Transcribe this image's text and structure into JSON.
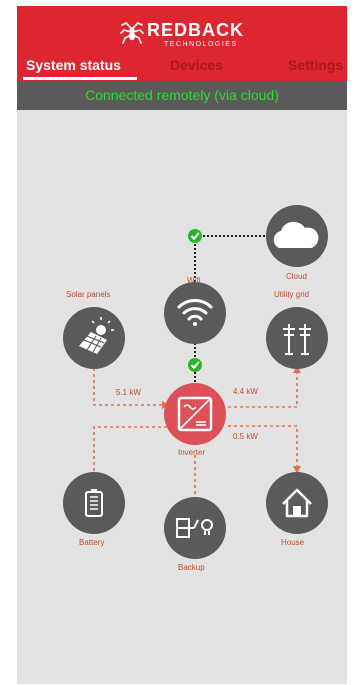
{
  "app": {
    "brand_name": "REDBACK",
    "brand_sub": "TECHNOLOGIES"
  },
  "tabs": [
    {
      "label": "System status",
      "active": true
    },
    {
      "label": "Devices",
      "active": false
    },
    {
      "label": "Settings",
      "active": false
    }
  ],
  "connection": {
    "status_text": "Connected remotely (via cloud)"
  },
  "nodes": {
    "cloud": {
      "label": "Cloud",
      "icon": "cloud-icon"
    },
    "wifi": {
      "label": "Wifi",
      "icon": "wifi-icon"
    },
    "solar": {
      "label": "Solar panels",
      "icon": "solar-panel-icon"
    },
    "grid": {
      "label": "Utility grid",
      "icon": "power-pylon-icon"
    },
    "inverter": {
      "label": "Inverter",
      "icon": "inverter-icon"
    },
    "battery": {
      "label": "Battery",
      "icon": "battery-icon"
    },
    "backup": {
      "label": "Backup",
      "icon": "backup-switch-icon"
    },
    "house": {
      "label": "House",
      "icon": "house-icon"
    }
  },
  "flows": {
    "solar_power": "5.1 kW",
    "grid_power": "4.4 kW",
    "house_power": "0.5 kW"
  },
  "colors": {
    "brand_red": "#dd2630",
    "node_gray": "#5a5a5a",
    "flow_orange": "#e9714a",
    "status_green": "#2bdc2b"
  }
}
